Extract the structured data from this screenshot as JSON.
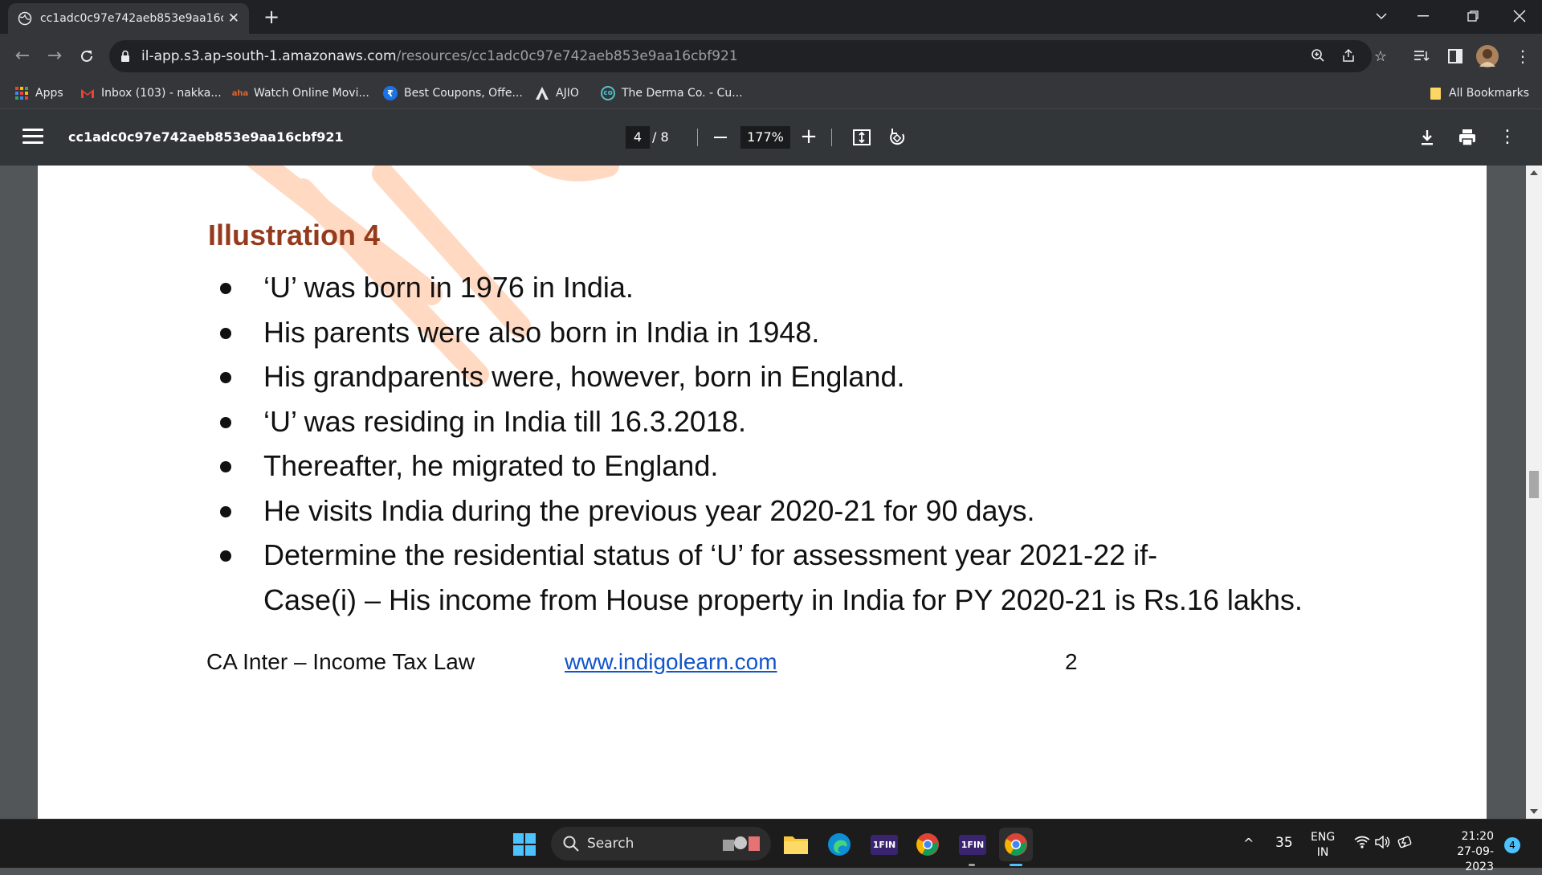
{
  "browser": {
    "tab_title": "cc1adc0c97e742aeb853e9aa16cbf921",
    "url_host": "il-app.s3.ap-south-1.amazonaws.com",
    "url_path": "/resources/cc1adc0c97e742aeb853e9aa16cbf921"
  },
  "bookmarks": {
    "items": [
      {
        "label": "Apps",
        "icon": "apps-grid-icon"
      },
      {
        "label": "Inbox (103) - nakka...",
        "icon": "gmail-icon"
      },
      {
        "label": "Watch Online Movi...",
        "icon": "movie-site-icon"
      },
      {
        "label": "Best Coupons, Offe...",
        "icon": "coupon-icon"
      },
      {
        "label": "AJIO",
        "icon": "ajio-icon"
      },
      {
        "label": "The Derma Co. - Cu...",
        "icon": "derma-icon"
      }
    ],
    "all_bookmarks": "All Bookmarks"
  },
  "pdf": {
    "title": "cc1adc0c97e742aeb853e9aa16cbf921",
    "current_page": "4",
    "total_pages": "/ 8",
    "zoom": "177%"
  },
  "document": {
    "heading": "Illustration 4",
    "bullets": [
      "‘U’ was born in 1976 in India.",
      "His parents were also born in India in 1948.",
      "His grandparents were, however, born in England.",
      "‘U’ was residing in India till 16.3.2018.",
      "Thereafter, he migrated to England.",
      "He visits India during the previous year 2020-21 for 90 days.",
      "Determine the residential status of ‘U’ for assessment year 2021-22 if-"
    ],
    "continuation": "Case(i) – His income from House property in India for PY 2020-21 is Rs.16 lakhs.",
    "footer_left": "CA Inter – Income Tax Law",
    "footer_link": "www.indigolearn.com",
    "footer_page": "2",
    "heading_color": "#953b1d",
    "link_color": "#1155cc"
  },
  "taskbar": {
    "search_label": "Search",
    "tray_count": "35",
    "lang_line1": "ENG",
    "lang_line2": "IN",
    "time": "21:20",
    "date": "27-09-2023",
    "notification_count": "4",
    "app_label_1fin": "1FIN"
  }
}
